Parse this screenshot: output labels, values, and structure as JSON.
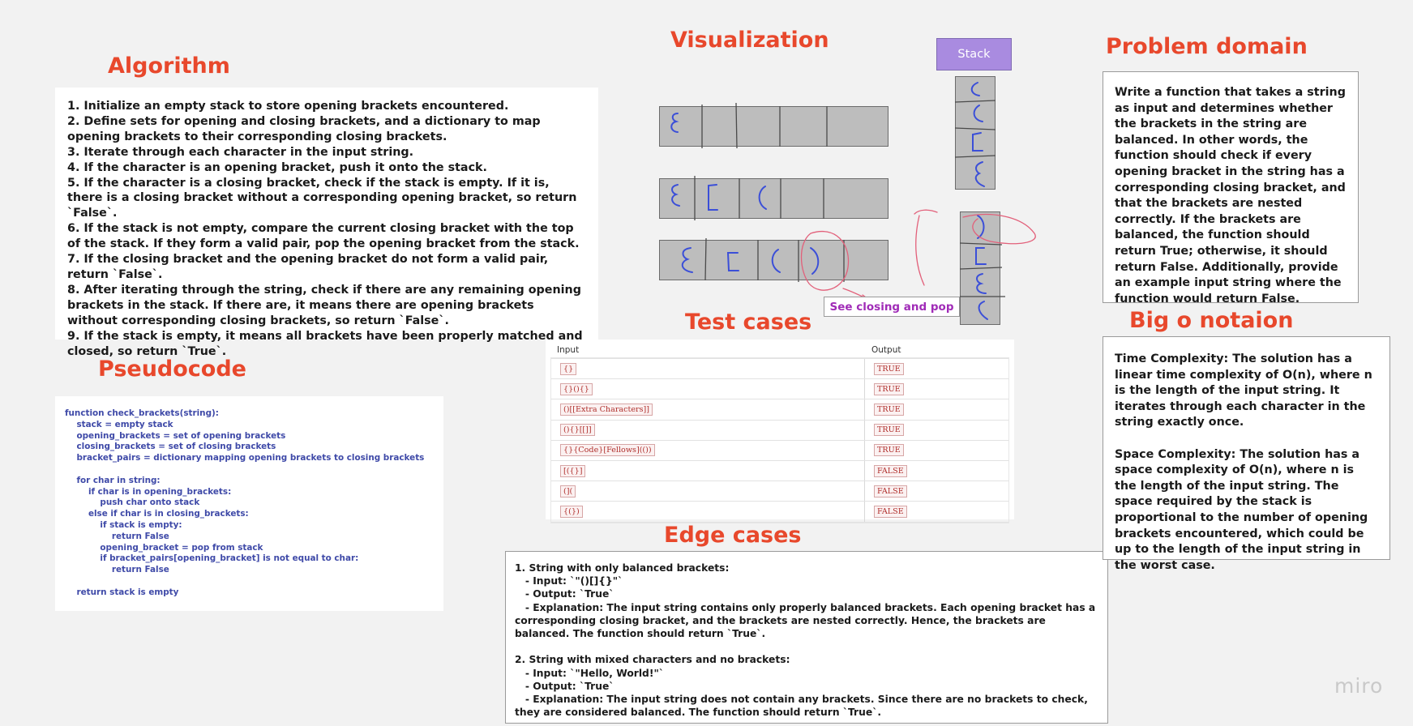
{
  "headings": {
    "algorithm": "Algorithm",
    "pseudocode": "Pseudocode",
    "visualization": "Visualization",
    "test_cases": "Test cases",
    "edge_cases": "Edge cases",
    "problem_domain": "Problem domain",
    "big_o": "Big o notaion"
  },
  "algorithm": [
    "1. Initialize an empty stack to store opening brackets encountered.",
    "2. Define sets for opening and closing brackets, and a dictionary to map opening brackets to their corresponding closing brackets.",
    "3. Iterate through each character in the input string.",
    "4. If the character is an opening bracket, push it onto the stack.",
    "5. If the character is a closing bracket, check if the stack is empty. If it is, there is a closing bracket without a corresponding opening bracket, so return `False`.",
    "6. If the stack is not empty, compare the current closing bracket with the top of the stack. If they form a valid pair, pop the opening bracket from the stack.",
    "7. If the closing bracket and the opening bracket do not form a valid pair, return `False`.",
    "8. After iterating through the string, check if there are any remaining opening brackets in the stack. If there are, it means there are opening brackets without corresponding closing brackets, so return `False`.",
    "9. If the stack is empty, it means all brackets have been properly matched and closed, so return `True`."
  ],
  "pseudocode": [
    "function check_brackets(string):",
    "    stack = empty stack",
    "    opening_brackets = set of opening brackets",
    "    closing_brackets = set of closing brackets",
    "    bracket_pairs = dictionary mapping opening brackets to closing brackets",
    "",
    "    for char in string:",
    "        if char is in opening_brackets:",
    "            push char onto stack",
    "        else if char is in closing_brackets:",
    "            if stack is empty:",
    "                return False",
    "            opening_bracket = pop from stack",
    "            if bracket_pairs[opening_bracket] is not equal to char:",
    "                return False",
    "",
    "    return stack is empty"
  ],
  "visualization": {
    "stack_label": "Stack",
    "note": "See closing and pop"
  },
  "test_cases": {
    "input_header": "Input",
    "output_header": "Output",
    "rows": [
      {
        "input": "{}",
        "output": "TRUE"
      },
      {
        "input": "{}(){}",
        "output": "TRUE"
      },
      {
        "input": "()[[Extra Characters]]",
        "output": "TRUE"
      },
      {
        "input": "(){}[[]]",
        "output": "TRUE"
      },
      {
        "input": "{}{Code}[Fellows](())",
        "output": "TRUE"
      },
      {
        "input": "[({}]",
        "output": "FALSE"
      },
      {
        "input": "(](",
        "output": "FALSE"
      },
      {
        "input": "{(})",
        "output": "FALSE"
      }
    ]
  },
  "edge_cases": [
    "1. String with only balanced brackets:",
    "   - Input: `\"()[]{}\"`",
    "   - Output: `True`",
    "   - Explanation: The input string contains only properly balanced brackets. Each opening bracket has a corresponding closing bracket, and the brackets are nested correctly. Hence, the brackets are balanced. The function should return `True`.",
    "",
    "2. String with mixed characters and no brackets:",
    "   - Input: `\"Hello, World!\"`",
    "   - Output: `True`",
    "   - Explanation: The input string does not contain any brackets. Since there are no brackets to check, they are considered balanced. The function should return `True`."
  ],
  "problem_domain": "Write a function that takes a string as input and determines whether the brackets in the string are balanced. In other words, the function should check if every opening bracket in the string has a corresponding closing bracket, and that the brackets are nested correctly. If the brackets are balanced, the function should return True; otherwise, it should return False. Additionally, provide an example input string where the function would return False.",
  "big_o": {
    "time": "Time Complexity: The solution has a linear time complexity of O(n), where n is the length of the input string. It iterates through each character in the string exactly once.",
    "space": "Space Complexity: The solution has a space complexity of O(n), where n is the length of the input string. The space required by the stack is proportional to the number of opening brackets encountered, which could be up to the length of the input string in the worst case."
  },
  "watermark": "miro",
  "colors": {
    "heading": "#e8482c",
    "pseudocode_text": "#3f4aa8",
    "stack_label_bg": "#a98be0",
    "note_text": "#a02bb7",
    "ink_blue": "#3b4fd8",
    "ink_red": "#e2607a"
  }
}
